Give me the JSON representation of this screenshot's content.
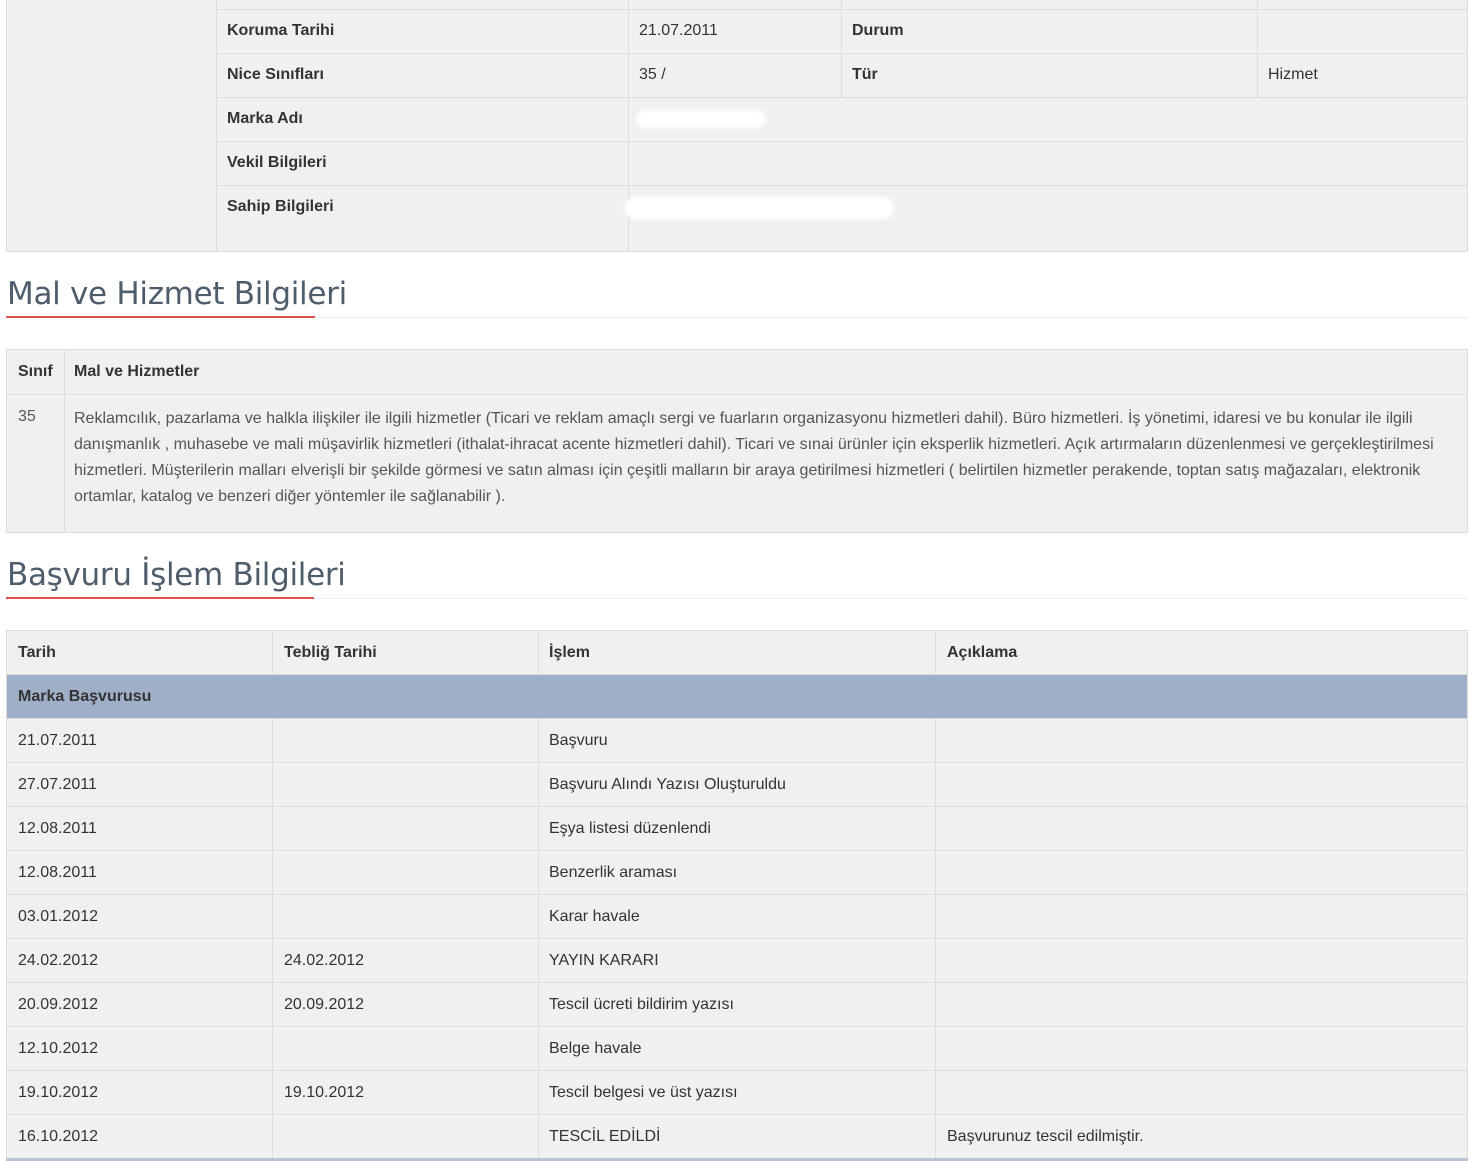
{
  "info": {
    "rows": [
      {
        "label": "",
        "value": "",
        "label2": "",
        "value2": ""
      },
      {
        "label": "Koruma Tarihi",
        "value": "21.07.2011",
        "label2": "Durum",
        "value2": ""
      },
      {
        "label": "Nice Sınıfları",
        "value": "35 /",
        "label2": "Tür",
        "value2": "Hizmet"
      },
      {
        "label": "Marka Adı",
        "value": ""
      },
      {
        "label": "Vekil Bilgileri",
        "value": ""
      },
      {
        "label": "Sahip Bilgileri",
        "value": ""
      }
    ]
  },
  "goods_section": {
    "title": "Mal ve Hizmet Bilgileri",
    "headers": [
      "Sınıf",
      "Mal ve Hizmetler"
    ],
    "rows": [
      {
        "class": "35",
        "text": "Reklamcılık, pazarlama ve halkla ilişkiler ile ilgili hizmetler (Ticari ve reklam amaçlı sergi ve fuarların organizasyonu hizmetleri dahil). Büro hizmetleri. İş yönetimi, idaresi ve bu konular ile ilgili danışmanlık , muhasebe ve mali müşavirlik hizmetleri (ithalat-ihracat acente hizmetleri dahil). Ticari ve sınai ürünler için eksperlik hizmetleri. Açık artırmaların düzenlenmesi ve gerçekleştirilmesi hizmetleri. Müşterilerin malları elverişli bir şekilde görmesi ve satın alması için çeşitli malların bir araya getirilmesi hizmetleri ( belirtilen hizmetler perakende, toptan satış mağazaları, elektronik ortamlar, katalog ve benzeri diğer yöntemler ile sağlanabilir )."
      }
    ]
  },
  "process_section": {
    "title": "Başvuru İşlem Bilgileri",
    "headers": [
      "Tarih",
      "Tebliğ Tarihi",
      "İşlem",
      "Açıklama"
    ],
    "group_label": "Marka Başvurusu",
    "rows": [
      {
        "date": "21.07.2011",
        "notice_date": "",
        "action": "Başvuru",
        "description": ""
      },
      {
        "date": "27.07.2011",
        "notice_date": "",
        "action": "Başvuru Alındı Yazısı Oluşturuldu",
        "description": ""
      },
      {
        "date": "12.08.2011",
        "notice_date": "",
        "action": "Eşya listesi düzenlendi",
        "description": ""
      },
      {
        "date": "12.08.2011",
        "notice_date": "",
        "action": "Benzerlik araması",
        "description": ""
      },
      {
        "date": "03.01.2012",
        "notice_date": "",
        "action": "Karar havale",
        "description": ""
      },
      {
        "date": "24.02.2012",
        "notice_date": "24.02.2012",
        "action": "YAYIN KARARI",
        "description": ""
      },
      {
        "date": "20.09.2012",
        "notice_date": "20.09.2012",
        "action": "Tescil ücreti bildirim yazısı",
        "description": ""
      },
      {
        "date": "12.10.2012",
        "notice_date": "",
        "action": "Belge havale",
        "description": ""
      },
      {
        "date": "19.10.2012",
        "notice_date": "19.10.2012",
        "action": "Tescil belgesi ve üst yazısı",
        "description": ""
      },
      {
        "date": "16.10.2012",
        "notice_date": "",
        "action": "TESCİL EDİLDİ",
        "description": "Başvurunuz tescil edilmiştir."
      }
    ]
  },
  "colors": {
    "accent": "#d9534f",
    "group_row": "#9fafc8",
    "table_bg": "#f0f0f0",
    "heading": "#4e5d6c"
  }
}
